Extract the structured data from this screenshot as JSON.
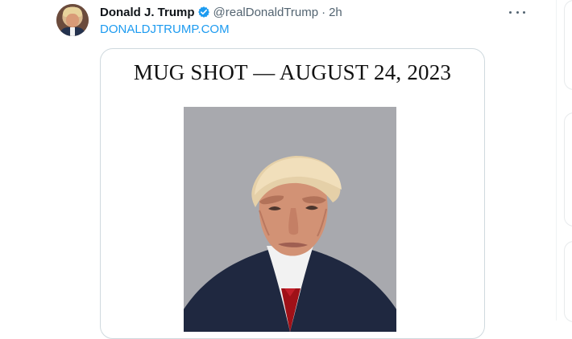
{
  "tweet": {
    "display_name": "Donald J. Trump",
    "handle": "@realDonaldTrump",
    "separator": "·",
    "time": "2h",
    "link_text": "DONALDJTRUMP.COM",
    "media_title": "MUG SHOT — AUGUST 24, 2023"
  },
  "icons": {
    "avatar": "avatar-photo",
    "verified": "verified-badge-icon",
    "more": "more-options-icon"
  },
  "colors": {
    "accent": "#1d9bf0",
    "text_primary": "#0f1419",
    "text_secondary": "#536471",
    "border": "#cfd9de"
  }
}
